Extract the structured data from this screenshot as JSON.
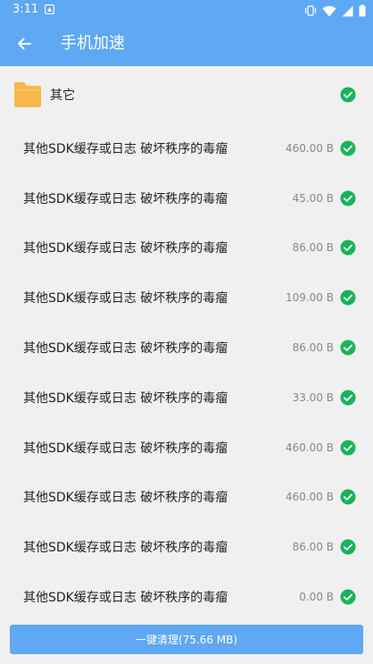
{
  "status_bar": {
    "time": "3:11",
    "icons": [
      "notification-icon",
      "vibrate-icon",
      "wifi-icon",
      "signal-icon",
      "battery-icon"
    ]
  },
  "app_bar": {
    "title": "手机加速",
    "back_icon": "back-arrow-icon"
  },
  "group": {
    "label": "其它",
    "icon": "folder-icon",
    "checked": true
  },
  "items": [
    {
      "label": "其他SDK缓存或日志 破坏秩序的毒瘤",
      "size": "460.00 B",
      "checked": true
    },
    {
      "label": "其他SDK缓存或日志 破坏秩序的毒瘤",
      "size": "45.00 B",
      "checked": true
    },
    {
      "label": "其他SDK缓存或日志 破坏秩序的毒瘤",
      "size": "86.00 B",
      "checked": true
    },
    {
      "label": "其他SDK缓存或日志 破坏秩序的毒瘤",
      "size": "109.00 B",
      "checked": true
    },
    {
      "label": "其他SDK缓存或日志 破坏秩序的毒瘤",
      "size": "86.00 B",
      "checked": true
    },
    {
      "label": "其他SDK缓存或日志 破坏秩序的毒瘤",
      "size": "33.00 B",
      "checked": true
    },
    {
      "label": "其他SDK缓存或日志 破坏秩序的毒瘤",
      "size": "460.00 B",
      "checked": true
    },
    {
      "label": "其他SDK缓存或日志 破坏秩序的毒瘤",
      "size": "460.00 B",
      "checked": true
    },
    {
      "label": "其他SDK缓存或日志 破坏秩序的毒瘤",
      "size": "86.00 B",
      "checked": true
    },
    {
      "label": "其他SDK缓存或日志 破坏秩序的毒瘤",
      "size": "0.00 B",
      "checked": true
    }
  ],
  "action_button": {
    "label": "一键清理(75.66 MB)"
  },
  "colors": {
    "primary": "#5ea8f4",
    "check": "#19b35a",
    "folder": "#f7b84b",
    "background": "#f0f0f0"
  }
}
